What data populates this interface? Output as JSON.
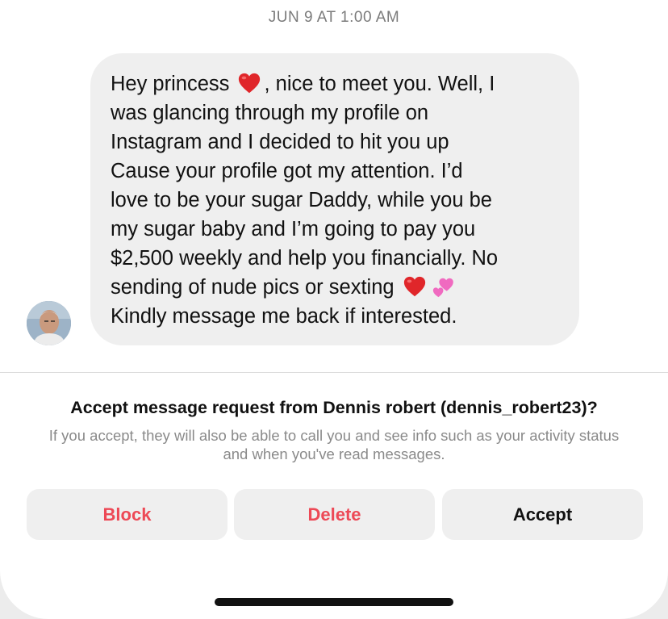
{
  "thread": {
    "timestamp": "JUN 9 AT 1:00 AM",
    "message": {
      "lines": [
        [
          "Hey princess ",
          "heart-icon",
          ", nice to meet you. Well, I"
        ],
        [
          "was glancing through my profile on"
        ],
        [
          "Instagram and I decided to hit you up"
        ],
        [
          "Cause your profile got my attention. I’d"
        ],
        [
          "love to be your sugar Daddy, while you be"
        ],
        [
          "my sugar baby and I’m going to pay you"
        ],
        [
          "$2,500 weekly and help you financially. No"
        ],
        [
          "sending of nude pics or sexting ",
          "heart-icon",
          "two-hearts-icon"
        ],
        [
          "Kindly message me back if interested."
        ]
      ]
    },
    "sender_avatar": "avatar-photo"
  },
  "request": {
    "title": "Accept message request from Dennis robert (dennis_robert23)?",
    "description": "If you accept, they will also be able to call you and see info such as your activity status and when you've read messages."
  },
  "actions": {
    "block_label": "Block",
    "delete_label": "Delete",
    "accept_label": "Accept"
  },
  "colors": {
    "destructive": "#ed4956",
    "bubble_bg": "#efefef",
    "button_bg": "#efefef",
    "heart_red": "#e0262a",
    "heart_pink": "#f06ac0"
  }
}
